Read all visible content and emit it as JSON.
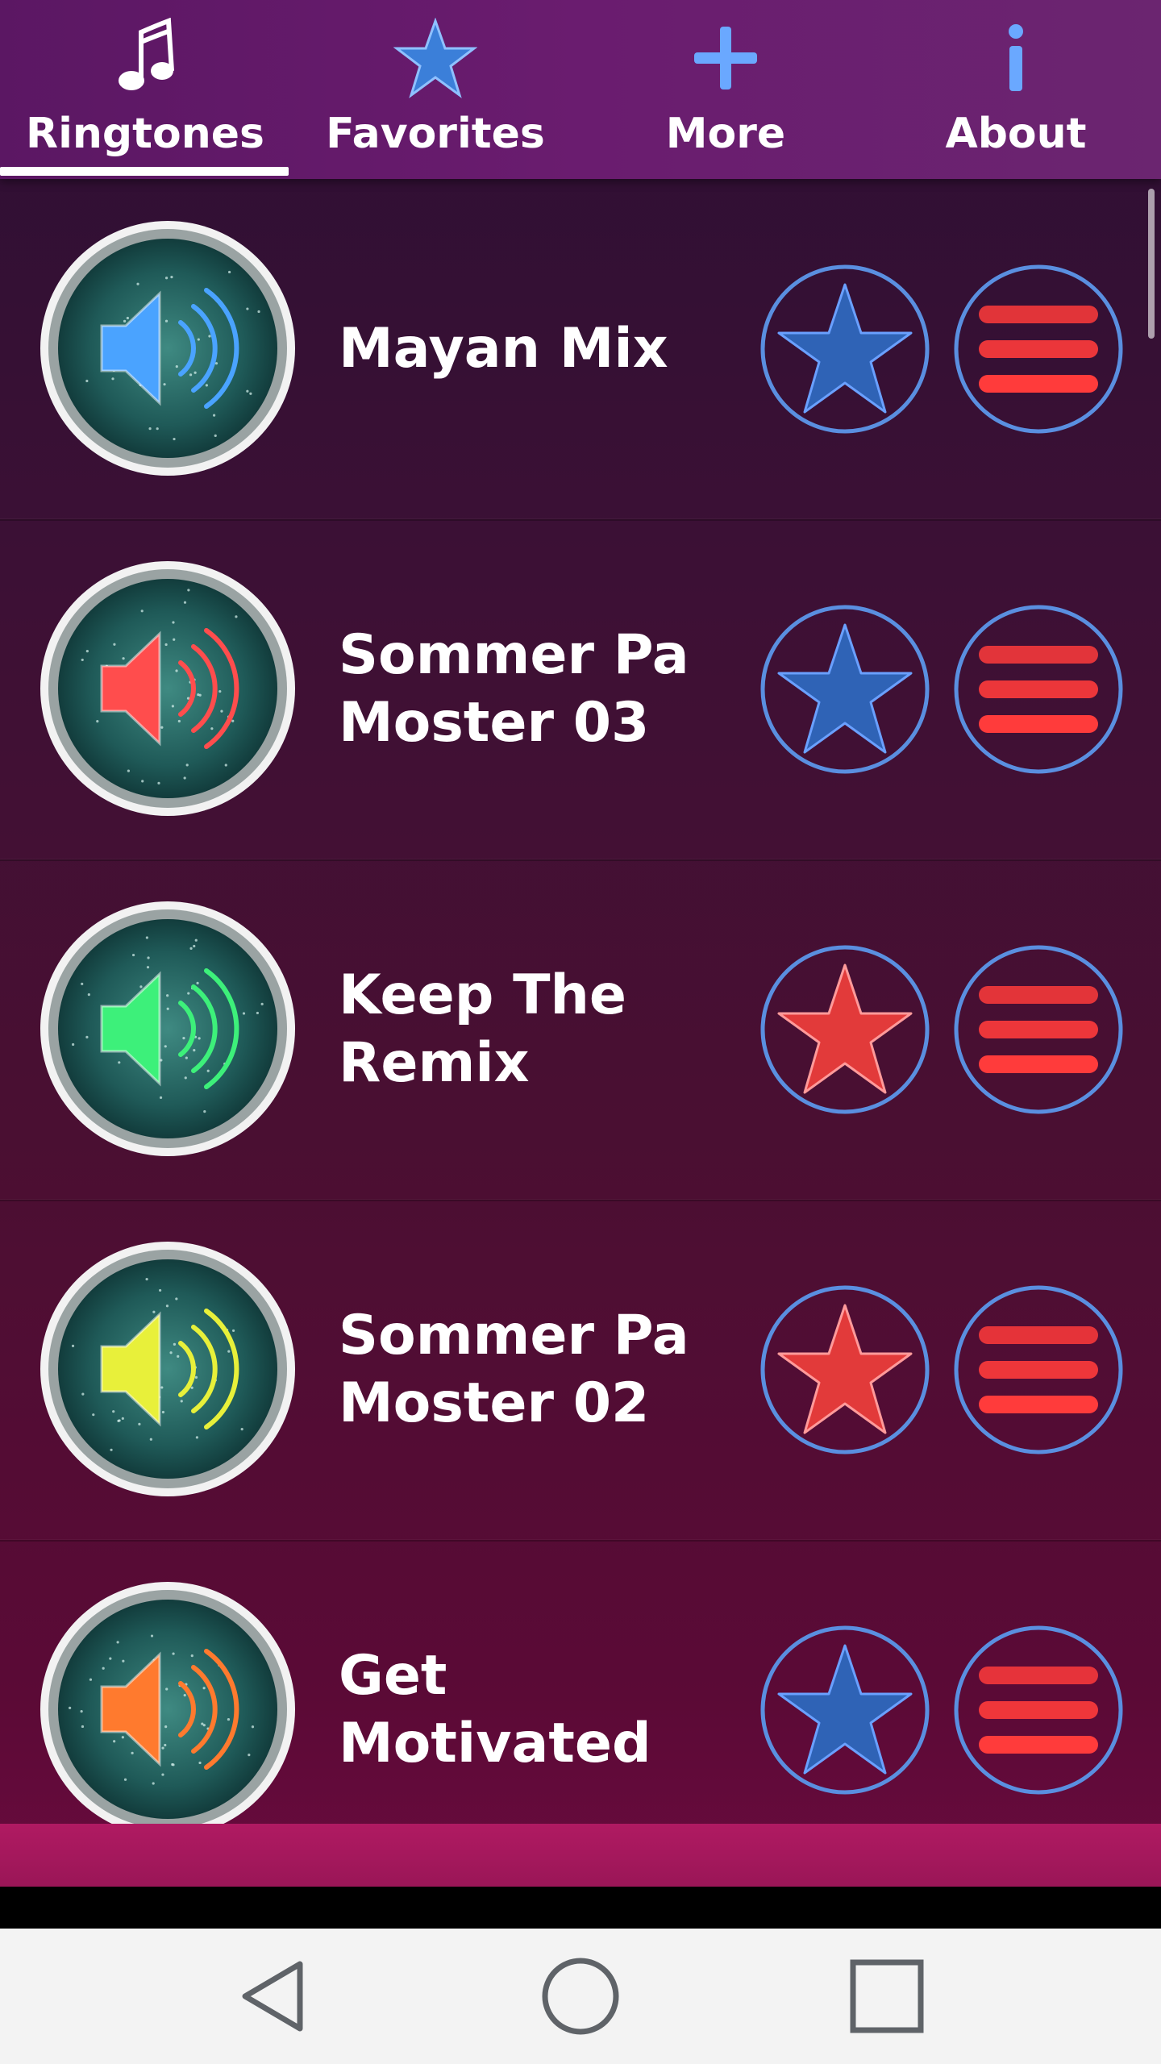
{
  "tabs": [
    {
      "label": "Ringtones",
      "icon": "music-note-icon",
      "active": true
    },
    {
      "label": "Favorites",
      "icon": "star-icon",
      "active": false
    },
    {
      "label": "More",
      "icon": "plus-icon",
      "active": false
    },
    {
      "label": "About",
      "icon": "info-icon",
      "active": false
    }
  ],
  "ringtones": [
    {
      "title": "Mayan Mix",
      "speaker_color": "#4aa3ff",
      "favorite": false
    },
    {
      "title": "Sommer Pa Moster 03",
      "speaker_color": "#ff4d4d",
      "favorite": false
    },
    {
      "title": "Keep The Remix",
      "speaker_color": "#3df07a",
      "favorite": true
    },
    {
      "title": "Sommer Pa Moster 02",
      "speaker_color": "#e8f03a",
      "favorite": true
    },
    {
      "title": "Get Motivated",
      "speaker_color": "#ff7a2e",
      "favorite": false
    }
  ],
  "colors": {
    "tab_bar": "#6a1c6f",
    "star_blue": "#2f63b6",
    "star_red": "#e23a3a",
    "ring_blue": "#5a8fe0",
    "menu_red": "#ff3b3b"
  },
  "nav": {
    "back_icon": "back-triangle-icon",
    "home_icon": "home-circle-icon",
    "recents_icon": "recents-square-icon"
  }
}
